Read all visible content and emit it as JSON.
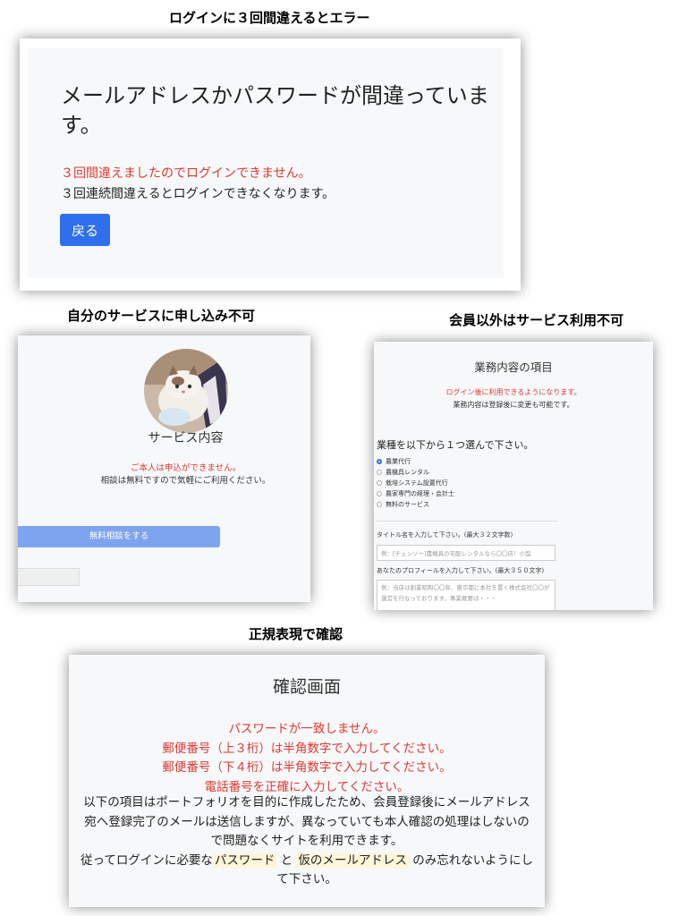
{
  "captions": {
    "login": "ログインに３回間違えるとエラー",
    "self": "自分のサービスに申し込み不可",
    "member": "会員以外はサービス利用不可",
    "regex": "正規表現で確認"
  },
  "login_error": {
    "heading": "メールアドレスかパスワードが間違っています。",
    "locked_message": "３回間違えましたのでログインできません。",
    "warning": "３回連続間違えるとログインできなくなります。",
    "back_button": "戻る"
  },
  "service_detail": {
    "title": "サービス内容",
    "error": "ご本人は申込ができません。",
    "note": "相談は無料ですので気軽にご利用ください。",
    "consult_button": "無料相談をする"
  },
  "business_items": {
    "title": "業務内容の項目",
    "login_note": "ログイン後に利用できるようになります。",
    "change_note": "業務内容は登録後に変更も可能です。",
    "question": "業種を以下から１つ選んで下さい。",
    "options": [
      "農業代行",
      "農機具レンタル",
      "栽培システム設置代行",
      "農家専門の経理・会計士",
      "無料のサービス"
    ],
    "selected_index": 0,
    "title_label": "タイトル名を入力して下さい。(最大３２文字数)",
    "title_placeholder": "例：[チェンソー]農機具の宅配レンタルなら〇〇店！小型",
    "profile_label": "あなたのプロフィールを入力して下さい。(最大３５０文字)",
    "profile_placeholder": "例：当店は創業昭和〇〇年、東京都に本社を置く株式会社〇〇が運営を行なっております。事業概要は・・・"
  },
  "confirm": {
    "title": "確認画面",
    "errors": [
      "パスワードが一致しません。",
      "郵便番号（上３桁）は半角数字で入力してください。",
      "郵便番号（下４桁）は半角数字で入力してください。",
      "電話番号を正確に入力してください。"
    ],
    "para_line1": "以下の項目はポートフォリオを目的に作成したため、会員登録後にメールアドレス",
    "para_line2": "宛へ登録完了のメールは送信しますが、異なっていても本人確認の処理はしないの",
    "para_line3": "で問題なくサイトを利用できます。",
    "para_line4_pre": "従ってログインに必要な",
    "highlight_password": "パスワード",
    "and": "と",
    "highlight_email": "仮のメールアドレス",
    "para_line4_post": "のみ忘れないようにし",
    "para_line5": "て下さい。"
  }
}
